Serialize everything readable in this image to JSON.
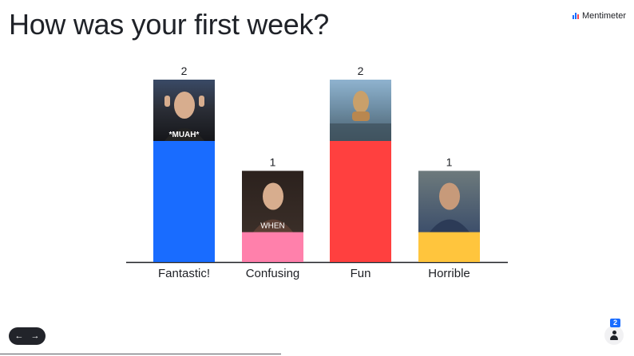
{
  "title": "How was your first week?",
  "brand": {
    "name": "Mentimeter",
    "icon": "mentimeter-logo-icon",
    "colors": [
      "#196cff",
      "#ff4551",
      "#1f2228"
    ]
  },
  "chart_data": {
    "type": "bar",
    "categories": [
      "Fantastic!",
      "Confusing",
      "Fun",
      "Horrible"
    ],
    "values": [
      2,
      1,
      2,
      1
    ],
    "colors": [
      "#196cff",
      "#ff80ab",
      "#ff403f",
      "#ffc53d"
    ],
    "ylim": [
      0,
      2
    ],
    "grid": false,
    "legend": "none",
    "data_labels": [
      "2",
      "1",
      "2",
      "1"
    ],
    "images": [
      {
        "depicts": "gif-woman-blowing-kiss",
        "caption": "*MUAH*"
      },
      {
        "depicts": "gif-woman-raising-eyebrow",
        "caption": "WHEN"
      },
      {
        "depicts": "gif-cat-walking-on-ocean",
        "caption": ""
      },
      {
        "depicts": "gif-man-holding-head",
        "caption": ""
      }
    ]
  },
  "navigation": {
    "prev_icon": "arrow-left-icon",
    "next_icon": "arrow-right-icon",
    "prev": "←",
    "next": "→"
  },
  "audience": {
    "count": "2",
    "icon": "person-icon"
  }
}
